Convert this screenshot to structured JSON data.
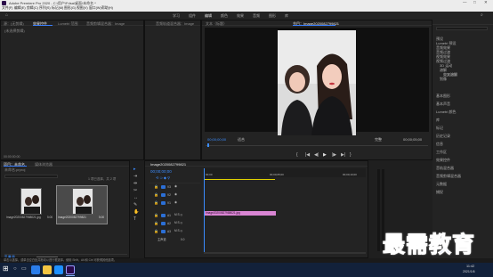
{
  "window": {
    "title": "Adobe Premiere Pro 2020 - C:\\用户\\Fdsa\\桌面\\未命名 *",
    "controls": [
      "—",
      "□",
      "✕"
    ]
  },
  "menubar": [
    "文件(F)",
    "编辑(E)",
    "剪辑(C)",
    "序列(S)",
    "标记(M)",
    "图形(G)",
    "视图(V)",
    "窗口(W)",
    "帮助(H)"
  ],
  "workspaces": [
    "学习",
    "组件",
    "编辑",
    "颜色",
    "效果",
    "音频",
    "图形",
    "库"
  ],
  "source_panel": {
    "tabs": [
      "源：(无剪辑)",
      "效果控件",
      "Lumetri 范围",
      "音频剪辑混合器：Image"
    ],
    "empty_text": "(未选择剪辑)",
    "timecode": "00:00:00:00"
  },
  "fx_panel": {
    "tab": "音频轨道混合器：Image"
  },
  "program_panel": {
    "tab": "节目：Image2020082799821",
    "tab_extra": "文本（标题）",
    "timecode_left": "00;00;00;00",
    "fit": "适合",
    "quality": "完整",
    "timecode_right": "00;00;05;00",
    "buttons": [
      "{",
      "|◀",
      "◀|",
      "▶",
      "|▶",
      "▶|",
      "}"
    ]
  },
  "right_panel": {
    "tree": [
      "预设",
      "Lumetri 预设",
      "音频效果",
      "音频过渡",
      "视频效果",
      "视频过渡",
      "3D 运动",
      "溶解",
      "交叉溶解",
      "划像"
    ],
    "sections": [
      "基本图形",
      "基本声音",
      "Lumetri 颜色",
      "库",
      "标记",
      "历史记录",
      "信息",
      "工作区",
      "效果控件",
      "音轨混合器",
      "音频剪辑混合器",
      "元数据",
      "捕捉"
    ]
  },
  "project_panel": {
    "tabs": [
      "项目：未命名",
      "媒体浏览器"
    ],
    "path": "未命名.prproj",
    "count": "1 项已选择，共 2 项",
    "items": [
      {
        "name": "Image20200827988021.jpg",
        "duration": "5:00"
      },
      {
        "name": "Image2020082799821",
        "duration": "5:00"
      }
    ]
  },
  "timeline": {
    "tab": "Image2020082799821",
    "timecode": "00;00;00;00",
    "ruler": [
      "00;00",
      "00;00;05;00",
      "00;00;10;00"
    ],
    "video_tracks": [
      "V3",
      "V2",
      "V1"
    ],
    "audio_tracks": [
      "A1",
      "A2",
      "A3"
    ],
    "master": "主声道",
    "master_value": "0.0",
    "clip_label": "Image20200827988021.jpg"
  },
  "status": {
    "text": "单击以选择，或单击空白处并拖动以进行框选择。使用 Shift、Alt 和 Ctrl 可获得其他选项。"
  },
  "taskbar": {
    "time": "11:42",
    "date": "2021/1/6"
  },
  "watermark": "最需教育",
  "colors": {
    "accent": "#3b8cff",
    "clip": "#d985d3",
    "panel_bg": "#232323",
    "taskbar": "#12213a"
  }
}
